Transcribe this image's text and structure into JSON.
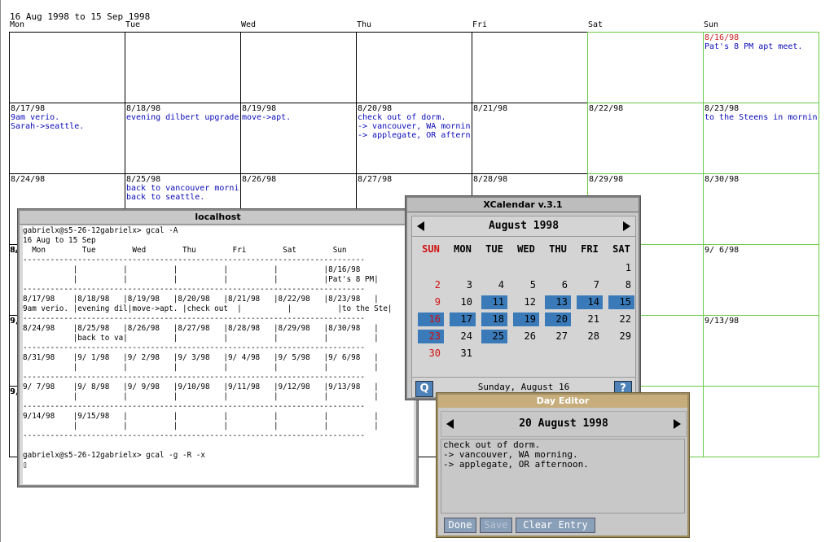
{
  "calendar": {
    "range": "16 Aug 1998 to 15 Sep 1998",
    "days": [
      "Mon",
      "Tue",
      "Wed",
      "Thu",
      "Fri",
      "Sat",
      "Sun"
    ],
    "weeks": [
      [
        {
          "d": ""
        },
        {
          "d": ""
        },
        {
          "d": ""
        },
        {
          "d": ""
        },
        {
          "d": ""
        },
        {
          "d": ""
        },
        {
          "d": "8/16/98",
          "today": true,
          "ev": [
            "Pat's 8 PM apt meet."
          ]
        }
      ],
      [
        {
          "d": "8/17/98",
          "ev": [
            "9am verio.",
            "Sarah->seattle."
          ]
        },
        {
          "d": "8/18/98",
          "ev": [
            "evening dilbert upgrade"
          ]
        },
        {
          "d": "8/19/98",
          "ev": [
            "move->apt."
          ]
        },
        {
          "d": "8/20/98",
          "ev": [
            "check out of dorm.",
            "-> vancouver, WA mornin",
            "-> applegate, OR aftern"
          ]
        },
        {
          "d": "8/21/98"
        },
        {
          "d": "8/22/98"
        },
        {
          "d": "8/23/98",
          "ev": [
            "to the Steens in mornin"
          ]
        }
      ],
      [
        {
          "d": "8/24/98"
        },
        {
          "d": "8/25/98",
          "ev": [
            "back to vancouver morni",
            "back to seattle."
          ]
        },
        {
          "d": "8/26/98"
        },
        {
          "d": "8/27/98"
        },
        {
          "d": "8/28/98"
        },
        {
          "d": "8/29/98"
        },
        {
          "d": "8/30/98"
        }
      ],
      [
        {
          "d": "8/31/98"
        },
        {
          "d": ""
        },
        {
          "d": ""
        },
        {
          "d": ""
        },
        {
          "d": ""
        },
        {
          "d": ""
        },
        {
          "d": "9/ 6/98"
        }
      ],
      [
        {
          "d": "9/ 7/98"
        },
        {
          "d": ""
        },
        {
          "d": ""
        },
        {
          "d": ""
        },
        {
          "d": ""
        },
        {
          "d": ""
        },
        {
          "d": "9/13/98"
        }
      ],
      [
        {
          "d": "9/14/98"
        },
        {
          "d": ""
        },
        {
          "d": ""
        },
        {
          "d": ""
        },
        {
          "d": ""
        },
        {
          "d": ""
        },
        {
          "d": ""
        }
      ]
    ],
    "hidden_partials": [
      "8/",
      "9,",
      "9,"
    ]
  },
  "terminal": {
    "title": "localhost",
    "content": "gabrielx@s5-26-12gabrielx> gcal -A\n16 Aug to 15 Sep\n  Mon        Tue        Wed        Thu        Fri        Sat        Sun\n---------------------------------------------------------------------------\n           |          |          |          |          |          |8/16/98\n           |          |          |          |          |          |Pat's 8 PM|\n---------------------------------------------------------------------------\n8/17/98    |8/18/98   |8/19/98   |8/20/98   |8/21/98   |8/22/98   |8/23/98   |\n9am verio. |evening dil|move->apt. |check out  |          |          |to the Ste|\n---------------------------------------------------------------------------\n8/24/98    |8/25/98   |8/26/98   |8/27/98   |8/28/98   |8/29/98   |8/30/98   |\n           |back to va|          |          |          |          |          |\n---------------------------------------------------------------------------\n8/31/98    |9/ 1/98   |9/ 2/98   |9/ 3/98   |9/ 4/98   |9/ 5/98   |9/ 6/98   |\n           |          |          |          |          |          |          |\n---------------------------------------------------------------------------\n9/ 7/98    |9/ 8/98   |9/ 9/98   |9/10/98   |9/11/98   |9/12/98   |9/13/98   |\n           |          |          |          |          |          |          |\n---------------------------------------------------------------------------\n9/14/98    |9/15/98   |          |          |          |          |          |\n           |          |          |          |          |          |          |\n---------------------------------------------------------------------------\n\ngabrielx@s5-26-12gabrielx> gcal -g -R -x\n▯"
  },
  "xcalendar": {
    "title": "XCalendar v.3.1",
    "month": "August 1998",
    "weekdays": [
      "SUN",
      "MON",
      "TUE",
      "WED",
      "THU",
      "FRI",
      "SAT"
    ],
    "cells": [
      [
        "",
        "",
        "",
        "",
        "",
        "",
        "1"
      ],
      [
        "2",
        "3",
        "4",
        "5",
        "6",
        "7",
        "8"
      ],
      [
        "9",
        "10",
        "11",
        "12",
        "13",
        "14",
        "15"
      ],
      [
        "16",
        "17",
        "18",
        "19",
        "20",
        "21",
        "22"
      ],
      [
        "23",
        "24",
        "25",
        "26",
        "27",
        "28",
        "29"
      ],
      [
        "30",
        "31",
        "",
        "",
        "",
        "",
        ""
      ]
    ],
    "highlighted": [
      "11",
      "13",
      "14",
      "15",
      "16",
      "17",
      "18",
      "19",
      "20",
      "23",
      "25"
    ],
    "footer_date": "Sunday, August 16",
    "quit_label": "Q",
    "help_label": "?",
    "accent_color": "#3a7ab8",
    "sunday_color": "#d01010"
  },
  "day_editor": {
    "title": "Day Editor",
    "date": "20 August 1998",
    "text": "check out of dorm.\n-> vancouver, WA morning.\n-> applegate, OR afternoon.",
    "buttons": {
      "done": "Done",
      "save": "Save",
      "clear": "Clear Entry"
    }
  }
}
